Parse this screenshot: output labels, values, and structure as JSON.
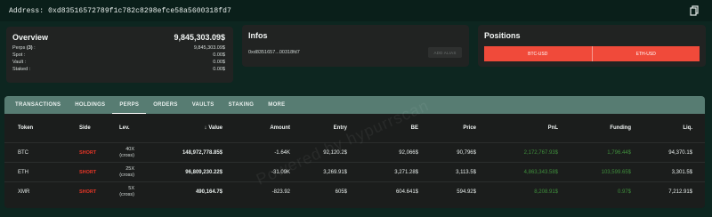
{
  "address": {
    "label": "Address: 0xd83516572789f1c782c8298efce58a5600318fd7"
  },
  "overview": {
    "title": "Overview",
    "total": "9,845,303.09$",
    "rows": [
      {
        "label_prefix": "Perps",
        "count": "(3)",
        "label_suffix": " :",
        "value": "9,845,303.09$"
      },
      {
        "label": "Spot :",
        "value": "0.00$"
      },
      {
        "label": "Vault :",
        "value": "0.00$"
      },
      {
        "label": "Staked :",
        "value": "0.00$"
      }
    ]
  },
  "infos": {
    "title": "Infos",
    "address_short": "0xd8351657...00318fd7",
    "add_alias_label": "ADD ALIAS"
  },
  "positions": {
    "title": "Positions",
    "segments": [
      {
        "label": "BTC-USD",
        "color": "#f04a3a"
      },
      {
        "label": "ETH-USD",
        "color": "#f04a3a"
      }
    ]
  },
  "tabs": [
    {
      "label": "TRANSACTIONS",
      "active": false
    },
    {
      "label": "HOLDINGS",
      "active": false
    },
    {
      "label": "PERPS",
      "active": true
    },
    {
      "label": "ORDERS",
      "active": false
    },
    {
      "label": "VAULTS",
      "active": false
    },
    {
      "label": "STAKING",
      "active": false
    },
    {
      "label": "MORE",
      "active": false
    }
  ],
  "table": {
    "headers": {
      "token": "Token",
      "side": "Side",
      "lev": "Lev.",
      "value": "Value",
      "amount": "Amount",
      "entry": "Entry",
      "be": "BE",
      "price": "Price",
      "pnl": "PnL",
      "funding": "Funding",
      "liq": "Liq."
    },
    "sort_icon": "arrow-down-icon",
    "rows": [
      {
        "token": "BTC",
        "side": "SHORT",
        "lev": "40X",
        "lev_mode": "(cross)",
        "value": "148,972,778.85$",
        "amount": "-1.64K",
        "entry": "92,120.2$",
        "be": "92,066$",
        "price": "90,796$",
        "pnl": "2,172,767.93$",
        "funding": "1,796.44$",
        "liq": "94,370.1$"
      },
      {
        "token": "ETH",
        "side": "SHORT",
        "lev": "25X",
        "lev_mode": "(cross)",
        "value": "96,809,230.22$",
        "amount": "-31.09K",
        "entry": "3,269.91$",
        "be": "3,271.28$",
        "price": "3,113.5$",
        "pnl": "4,863,343.58$",
        "funding": "103,599.65$",
        "liq": "3,301.5$"
      },
      {
        "token": "XMR",
        "side": "SHORT",
        "lev": "5X",
        "lev_mode": "(cross)",
        "value": "490,164.7$",
        "amount": "-823.92",
        "entry": "605$",
        "be": "604.641$",
        "price": "594.92$",
        "pnl": "8,208.91$",
        "funding": "0.97$",
        "liq": "7,212.91$"
      }
    ]
  },
  "colors": {
    "background": "#0d2620",
    "tab_bar": "#577c72",
    "short": "#e53526",
    "position_bar": "#f04a3a",
    "pnl_positive": "#3f8f3c"
  },
  "watermark": "Powered by hypurrscan"
}
